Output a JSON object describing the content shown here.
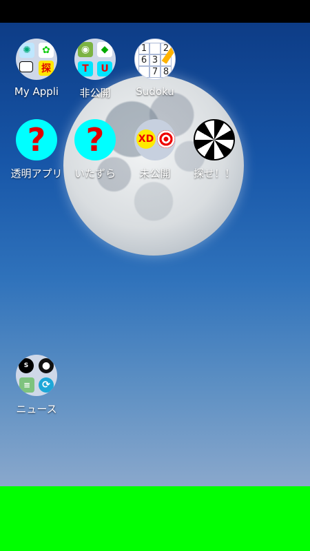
{
  "apps": [
    {
      "label": "My Appli"
    },
    {
      "label": "非公開",
      "mini": [
        "T",
        "U"
      ]
    },
    {
      "label": "Sudoku",
      "grid": [
        "1",
        "",
        "2",
        "6",
        "3",
        "4",
        "",
        "7",
        "8"
      ]
    },
    {
      "label": "透明アプリ",
      "mark": "?"
    },
    {
      "label": "いたずら",
      "mark": "?"
    },
    {
      "label": "未公開",
      "badge": "XD"
    },
    {
      "label": "探せ！！"
    },
    {
      "label": "ニュース"
    }
  ],
  "my_appli_badge": "探",
  "colors": {
    "wallpaper_top": "#0d3c86",
    "bottom_bar": "#00ff00",
    "question_bg": "#00ffff",
    "question_mark": "#e00000"
  }
}
